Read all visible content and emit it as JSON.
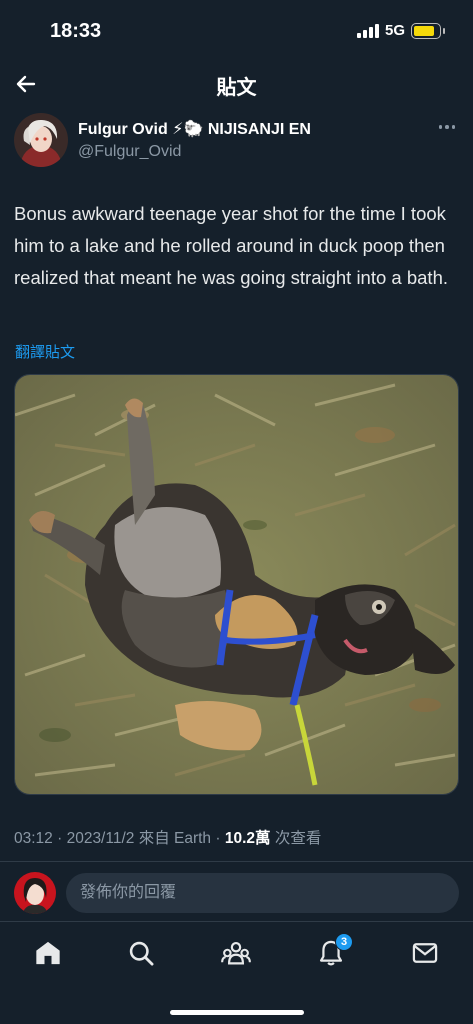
{
  "status_bar": {
    "time": "18:33",
    "network": "5G",
    "battery_level": 0.85,
    "battery_color": "#f5d90a"
  },
  "header": {
    "title": "貼文",
    "back_icon": "arrow-left-icon"
  },
  "author": {
    "name": "Fulgur Ovid ⚡🐑 NIJISANJI EN",
    "handle": "@Fulgur_Ovid",
    "more_icon": "more-dots-icon"
  },
  "tweet": {
    "text": "Bonus awkward teenage year shot for the time I took him to a lake and he rolled around in duck poop then realized that meant he was going straight into a bath.",
    "translate_label": "翻譯貼文",
    "photo_subject": "dog-photo"
  },
  "meta": {
    "time": "03:12",
    "date": "2023/11/2",
    "source": "來自 Earth",
    "views_count": "10.2萬",
    "views_label": "次查看"
  },
  "reply": {
    "placeholder": "發佈你的回覆"
  },
  "tabbar": {
    "items": [
      {
        "icon": "home-icon",
        "active": true
      },
      {
        "icon": "search-icon"
      },
      {
        "icon": "communities-icon"
      },
      {
        "icon": "bell-icon",
        "badge": "3"
      },
      {
        "icon": "mail-icon"
      }
    ]
  },
  "colors": {
    "background": "#15202b",
    "accent": "#1d9bf0",
    "muted": "#8b98a5",
    "text": "#e7e9ea"
  }
}
